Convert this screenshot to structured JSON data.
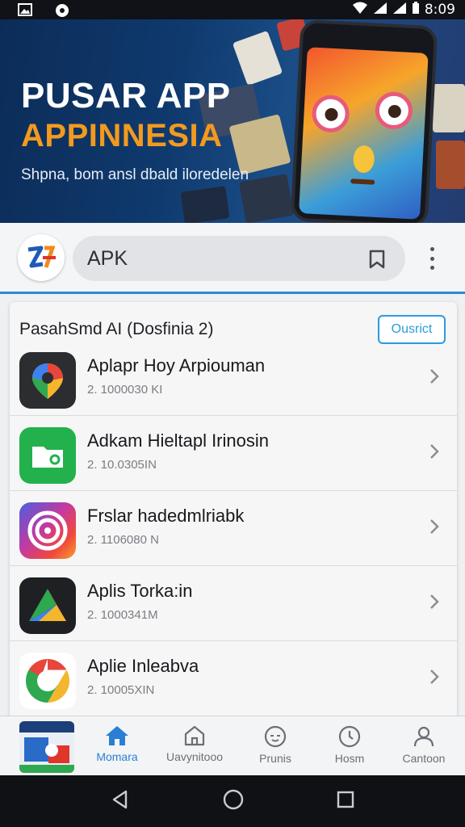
{
  "status_bar": {
    "time": "8:09",
    "icons": [
      "gallery-icon",
      "record-icon",
      "wifi-icon",
      "signal-icon",
      "signal-icon",
      "battery-icon"
    ]
  },
  "banner": {
    "title_line1": "PUSAR APP",
    "title_line2": "APPINNESIA",
    "subtitle": "Shpna, bom ansl dbald iloredelen"
  },
  "search": {
    "value": "APK",
    "icons": [
      "app-logo",
      "bookmark-icon",
      "more-vert-icon"
    ]
  },
  "list_section": {
    "title": "PasahSmd AI (Dosfinia 2)",
    "action_label": "Ousrict",
    "items": [
      {
        "name": "Aplapr Hoy Arpiouman",
        "size": "2. 1000030 KI",
        "icon": "maps-pin-icon"
      },
      {
        "name": "Adkam Hieltapl Irinosin",
        "size": "2. 10.0305IN",
        "icon": "folder-icon"
      },
      {
        "name": "Frslar hadedmlriabk",
        "size": "2. 1106080 N",
        "icon": "spiral-icon"
      },
      {
        "name": "Aplis Torka:in",
        "size": "2. 1000341M",
        "icon": "play-triangle-icon"
      },
      {
        "name": "Aplie Inleabva",
        "size": "2. 10005XIN",
        "icon": "chrome-icon"
      }
    ]
  },
  "bottom_nav": {
    "items": [
      {
        "label": "Momara",
        "icon": "home-icon",
        "active": true
      },
      {
        "label": "Uavynitooo",
        "icon": "house-outline-icon",
        "active": false
      },
      {
        "label": "Prunis",
        "icon": "clock-face-icon",
        "active": false
      },
      {
        "label": "Hosm",
        "icon": "power-clock-icon",
        "active": false
      },
      {
        "label": "Cantoon",
        "icon": "person-icon",
        "active": false
      }
    ]
  },
  "colors": {
    "accent": "#2a7fd4",
    "banner_orange": "#f39a1e",
    "banner_bg": "#0f3a6e"
  }
}
